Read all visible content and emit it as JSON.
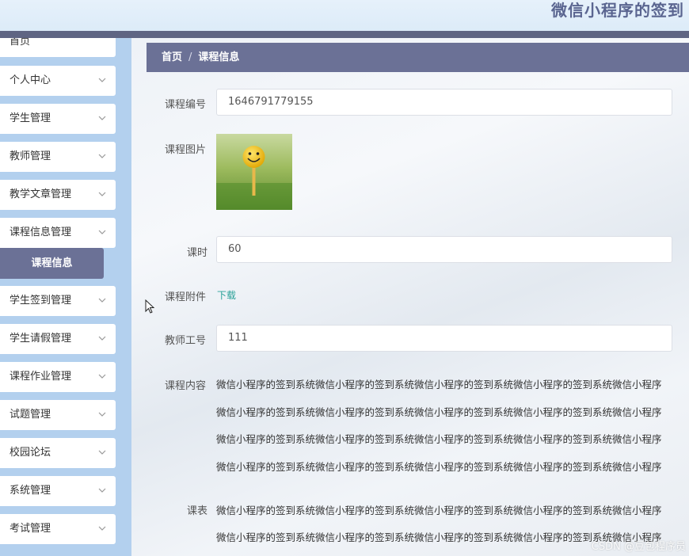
{
  "header": {
    "title": "微信小程序的签到"
  },
  "sidebar": {
    "items": [
      {
        "label": "首页",
        "has_chevron": false
      },
      {
        "label": "个人中心",
        "has_chevron": true
      },
      {
        "label": "学生管理",
        "has_chevron": true
      },
      {
        "label": "教师管理",
        "has_chevron": true
      },
      {
        "label": "教学文章管理",
        "has_chevron": true
      },
      {
        "label": "课程信息管理",
        "has_chevron": true
      },
      {
        "label": "学生签到管理",
        "has_chevron": true
      },
      {
        "label": "学生请假管理",
        "has_chevron": true
      },
      {
        "label": "课程作业管理",
        "has_chevron": true
      },
      {
        "label": "试题管理",
        "has_chevron": true
      },
      {
        "label": "校园论坛",
        "has_chevron": true
      },
      {
        "label": "系统管理",
        "has_chevron": true
      },
      {
        "label": "考试管理",
        "has_chevron": true
      }
    ],
    "active_sub": "课程信息"
  },
  "breadcrumb": {
    "home": "首页",
    "separator": "/",
    "current": "课程信息"
  },
  "form": {
    "course_no_label": "课程编号",
    "course_no_value": "1646791779155",
    "course_image_label": "课程图片",
    "hours_label": "课时",
    "hours_value": "60",
    "attachment_label": "课程附件",
    "attachment_link": "下载",
    "teacher_no_label": "教师工号",
    "teacher_no_value": "111",
    "content_label": "课程内容",
    "content_lines": [
      "微信小程序的签到系统微信小程序的签到系统微信小程序的签到系统微信小程序的签到系统微信小程序",
      "微信小程序的签到系统微信小程序的签到系统微信小程序的签到系统微信小程序的签到系统微信小程序",
      "微信小程序的签到系统微信小程序的签到系统微信小程序的签到系统微信小程序的签到系统微信小程序",
      "微信小程序的签到系统微信小程序的签到系统微信小程序的签到系统微信小程序的签到系统微信小程序"
    ],
    "schedule_label": "课表",
    "schedule_lines": [
      "微信小程序的签到系统微信小程序的签到系统微信小程序的签到系统微信小程序的签到系统微信小程序",
      "微信小程序的签到系统微信小程序的签到系统微信小程序的签到系统微信小程序的签到系统微信小程序"
    ]
  },
  "watermark": "CSDN @豆包程序员",
  "colors": {
    "sidebar_bg": "#b3d0ee",
    "accent": "#6b7196",
    "header_bar": "#5f6583",
    "link": "#2aa198"
  }
}
